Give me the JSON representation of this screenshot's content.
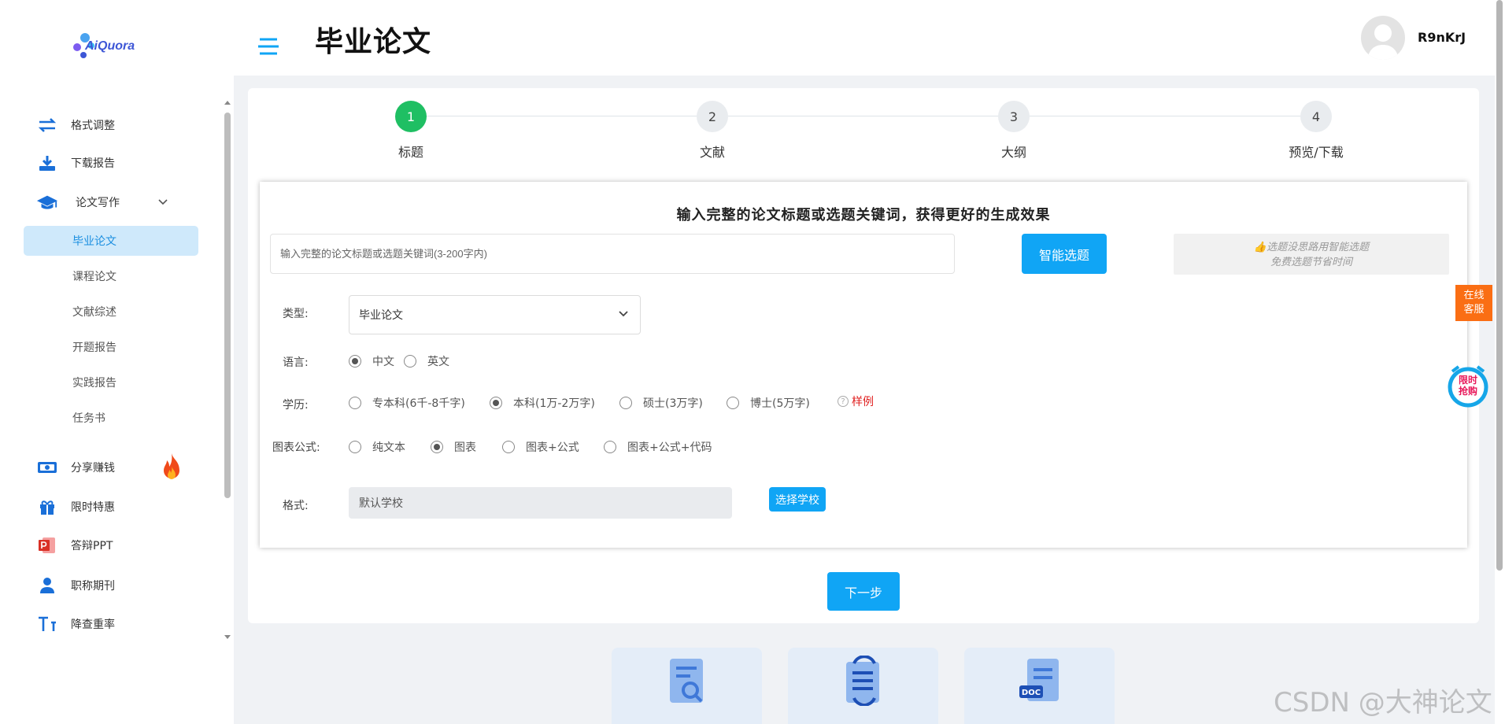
{
  "sidebar": {
    "logo_text": "AiQuora",
    "items": [
      {
        "label": "格式调整",
        "icon": "swap-arrows-icon"
      },
      {
        "label": "下载报告",
        "icon": "download-icon"
      },
      {
        "label": "论文写作",
        "icon": "graduation-cap-icon"
      }
    ],
    "sub_items": [
      {
        "label": "毕业论文",
        "active": true
      },
      {
        "label": "课程论文"
      },
      {
        "label": "文献综述"
      },
      {
        "label": "开题报告"
      },
      {
        "label": "实践报告"
      },
      {
        "label": "任务书"
      }
    ],
    "items_bottom": [
      {
        "label": "分享赚钱",
        "icon": "money-icon"
      },
      {
        "label": "限时特惠",
        "icon": "gift-icon"
      },
      {
        "label": "答辩PPT",
        "icon": "powerpoint-icon"
      },
      {
        "label": "职称期刊",
        "icon": "user-icon"
      },
      {
        "label": "降查重率",
        "icon": "text-size-icon"
      }
    ]
  },
  "header": {
    "title": "毕业论文",
    "username": "R9nKrJ"
  },
  "steps": [
    {
      "number": "1",
      "label": "标题",
      "active": true
    },
    {
      "number": "2",
      "label": "文献"
    },
    {
      "number": "3",
      "label": "大纲"
    },
    {
      "number": "4",
      "label": "预览/下载"
    }
  ],
  "form": {
    "heading": "输入完整的论文标题或选题关键词，获得更好的生成效果",
    "title_placeholder": "输入完整的论文标题或选题关键词(3-200字内)",
    "smart_button": "智能选题",
    "tip_line1": "选题没思路用智能选题",
    "tip_line2": "免费选题节省时间",
    "type_label": "类型:",
    "type_value": "毕业论文",
    "language_label": "语言:",
    "language_options": [
      "中文",
      "英文"
    ],
    "language_selected": "中文",
    "degree_label": "学历:",
    "degree_options": [
      "专本科(6千-8千字)",
      "本科(1万-2万字)",
      "硕士(3万字)",
      "博士(5万字)"
    ],
    "degree_selected": "本科(1万-2万字)",
    "sample_link": "样例",
    "chart_label": "图表公式:",
    "chart_options": [
      "纯文本",
      "图表",
      "图表+公式",
      "图表+公式+代码"
    ],
    "chart_selected": "图表",
    "format_label": "格式:",
    "format_value": "默认学校",
    "school_button": "选择学校",
    "next_button": "下一步"
  },
  "floating": {
    "service_line1": "在线",
    "service_line2": "客服",
    "flash_line1": "限时",
    "flash_line2": "抢购"
  },
  "watermark": "CSDN @大神论文",
  "colors": {
    "accent": "#10a5f5",
    "step_active": "#1fbf63",
    "service": "#fa6e14",
    "sample_link": "#e02020"
  }
}
